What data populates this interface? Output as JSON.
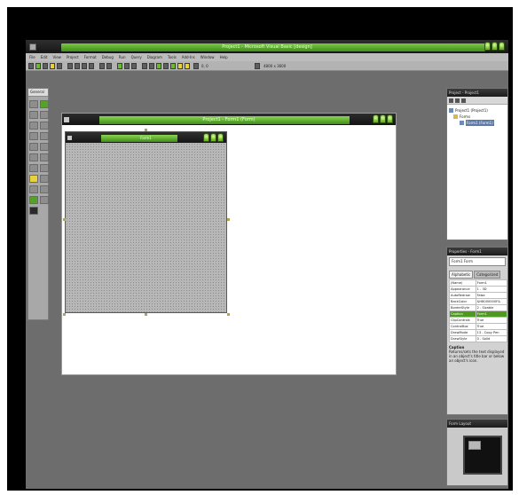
{
  "app": {
    "title": "Project1 - Microsoft Visual Basic [design]"
  },
  "menu": [
    "File",
    "Edit",
    "View",
    "Project",
    "Format",
    "Debug",
    "Run",
    "Query",
    "Diagram",
    "Tools",
    "Add-Ins",
    "Window",
    "Help"
  ],
  "toolbar": {
    "zoom_text": "0, 0",
    "size_text": "4800 x 3600"
  },
  "toolbox": {
    "title": "General"
  },
  "designer": {
    "title": "Project1 - Form1 (Form)"
  },
  "form1": {
    "title": "Form1"
  },
  "project_explorer": {
    "title": "Project - Project1",
    "tree": [
      {
        "label": "Project1 (Project1)",
        "level": 0
      },
      {
        "label": "Forms",
        "level": 1
      },
      {
        "label": "Form1 (Form1)",
        "level": 2,
        "selected": true
      }
    ]
  },
  "properties": {
    "title": "Properties - Form1",
    "object_combo": "Form1  Form",
    "tabs": [
      "Alphabetic",
      "Categorized"
    ],
    "rows": [
      {
        "name": "(Name)",
        "value": "Form1"
      },
      {
        "name": "Appearance",
        "value": "1 - 3D"
      },
      {
        "name": "AutoRedraw",
        "value": "False"
      },
      {
        "name": "BackColor",
        "value": "&H8000000F&"
      },
      {
        "name": "BorderStyle",
        "value": "2 - Sizable"
      },
      {
        "name": "Caption",
        "value": "Form1",
        "selected": true
      },
      {
        "name": "ClipControls",
        "value": "True"
      },
      {
        "name": "ControlBox",
        "value": "True"
      },
      {
        "name": "DrawMode",
        "value": "13 - Copy Pen"
      },
      {
        "name": "DrawStyle",
        "value": "0 - Solid"
      }
    ],
    "desc_title": "Caption",
    "desc_text": "Returns/sets the text displayed in an object's title bar or below an object's icon."
  },
  "form_layout": {
    "title": "Form Layout"
  }
}
